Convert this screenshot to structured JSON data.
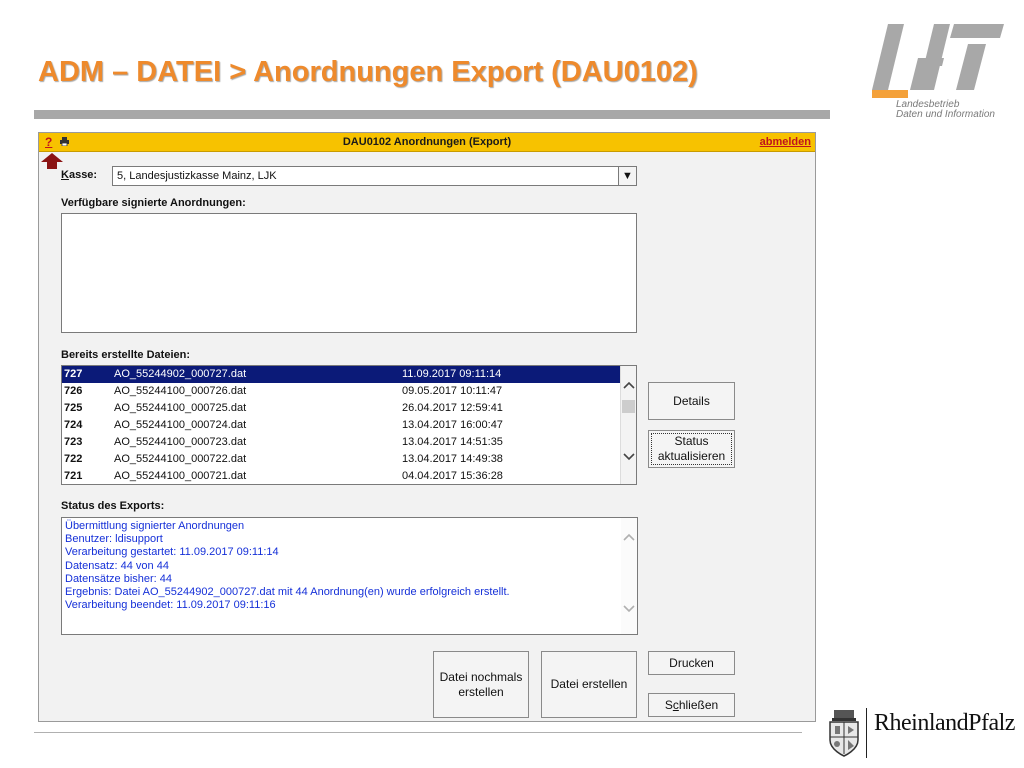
{
  "slide": {
    "title": "ADM – DATEI > Anordnungen Export (DAU0102)"
  },
  "logo": {
    "line1": "Landesbetrieb",
    "line2": "Daten und Information",
    "color_gray": "#a8a8a8",
    "color_orange": "#f4a13a"
  },
  "window": {
    "title": "DAU0102 Anordnungen (Export)",
    "help": "?",
    "print_icon": "printer-icon",
    "logout": "abmelden",
    "titlebar_color": "#f7c200"
  },
  "kasse": {
    "label_underlined": "K",
    "label_rest": "asse:",
    "value": "5, Landesjustizkasse Mainz, LJK",
    "dropdown_glyph": "▼"
  },
  "available": {
    "label": "Verfügbare signierte Anordnungen:"
  },
  "files": {
    "label": "Bereits erstellte Dateien:",
    "rows": [
      {
        "id": "727",
        "name": "AO_55244902_000727.dat",
        "date": "11.09.2017 09:11:14"
      },
      {
        "id": "726",
        "name": "AO_55244100_000726.dat",
        "date": "09.05.2017 10:11:47"
      },
      {
        "id": "725",
        "name": "AO_55244100_000725.dat",
        "date": "26.04.2017 12:59:41"
      },
      {
        "id": "724",
        "name": "AO_55244100_000724.dat",
        "date": "13.04.2017 16:00:47"
      },
      {
        "id": "723",
        "name": "AO_55244100_000723.dat",
        "date": "13.04.2017 14:51:35"
      },
      {
        "id": "722",
        "name": "AO_55244100_000722.dat",
        "date": "13.04.2017 14:49:38"
      },
      {
        "id": "721",
        "name": "AO_55244100_000721.dat",
        "date": "04.04.2017 15:36:28"
      }
    ],
    "selected_color": "#0b1a78"
  },
  "status": {
    "label": "Status des Exports:",
    "lines": [
      "Übermittlung signierter Anordnungen",
      "Benutzer: ldisupport",
      "Verarbeitung gestartet: 11.09.2017 09:11:14",
      "Datensatz: 44 von 44",
      "Datensätze bisher: 44",
      "Ergebnis: Datei AO_55244902_000727.dat mit 44 Anordnung(en) wurde erfolgreich erstellt.",
      "Verarbeitung beendet: 11.09.2017 09:11:16"
    ],
    "text_color": "#1530d8"
  },
  "buttons": {
    "details": "Details",
    "status_line1": "Status",
    "status_line2": "aktualisieren",
    "nochmals_line1": "Datei nochmals",
    "nochmals_line2": "erstellen",
    "erstellen": "Datei erstellen",
    "drucken": "Drucken",
    "schliessen_pre": "S",
    "schliessen_ul": "c",
    "schliessen_post": "hließen"
  },
  "footer": {
    "brand": "RheinlandPfalz"
  }
}
